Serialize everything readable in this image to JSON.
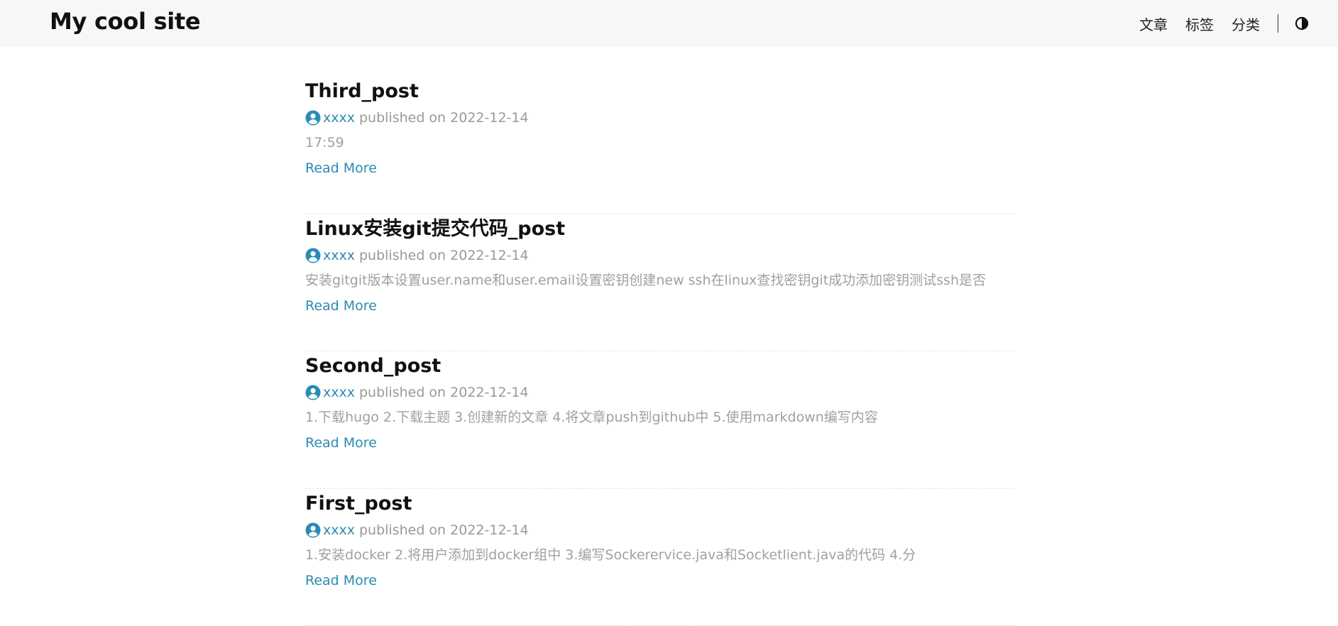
{
  "site": {
    "title": "My cool site"
  },
  "nav": {
    "items": [
      {
        "label": "文章"
      },
      {
        "label": "标签"
      },
      {
        "label": "分类"
      }
    ],
    "theme_toggle_icon": "contrast-icon"
  },
  "colors": {
    "accent": "#2a8bb5",
    "muted": "#999999",
    "navbar_bg": "#f7f7f7"
  },
  "posts": [
    {
      "title": "Third_post",
      "author": "xxxx",
      "published_text": "published on 2022-12-14",
      "summary": "17:59",
      "read_more": "Read More"
    },
    {
      "title": "Linux安装git提交代码_post",
      "author": "xxxx",
      "published_text": "published on 2022-12-14",
      "summary": "安装gitgit版本设置user.name和user.email设置密钥创建new ssh在linux查找密钥git成功添加密钥测试ssh是否",
      "read_more": "Read More"
    },
    {
      "title": "Second_post",
      "author": "xxxx",
      "published_text": "published on 2022-12-14",
      "summary": "1.下载hugo 2.下载主题 3.创建新的文章 4.将文章push到github中 5.使用markdown编写内容",
      "read_more": "Read More"
    },
    {
      "title": "First_post",
      "author": "xxxx",
      "published_text": "published on 2022-12-14",
      "summary": "1.安装docker 2.将用户添加到docker组中 3.编写Sockerervice.java和Socketlient.java的代码 4.分",
      "read_more": "Read More"
    }
  ]
}
